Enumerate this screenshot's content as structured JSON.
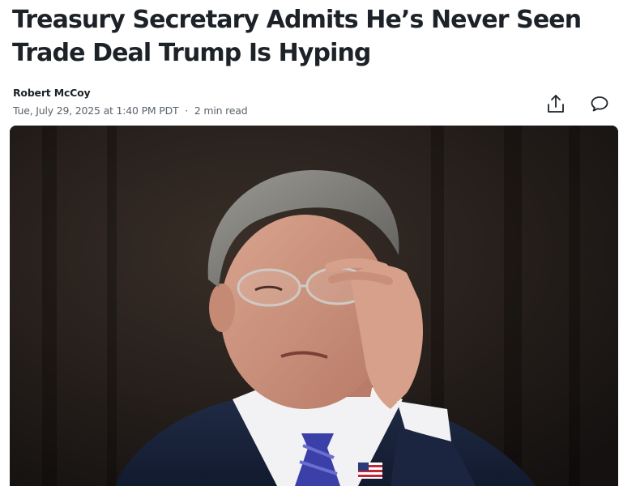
{
  "article": {
    "headline": "Treasury Secretary Admits He’s Never Seen Trade Deal Trump Is Hyping",
    "author": "Robert McCoy",
    "date": "Tue, July 29, 2025 at 1:40 PM PDT",
    "separator": "·",
    "read_time": "2 min read"
  },
  "actions": {
    "share_icon": "share-icon",
    "comment_icon": "comment-icon"
  },
  "hero_image": {
    "subject": "photo-of-man-adjusting-glasses"
  },
  "colors": {
    "headline": "#1d2228",
    "meta": "#5b636a",
    "photo_background": "#1a1715"
  }
}
